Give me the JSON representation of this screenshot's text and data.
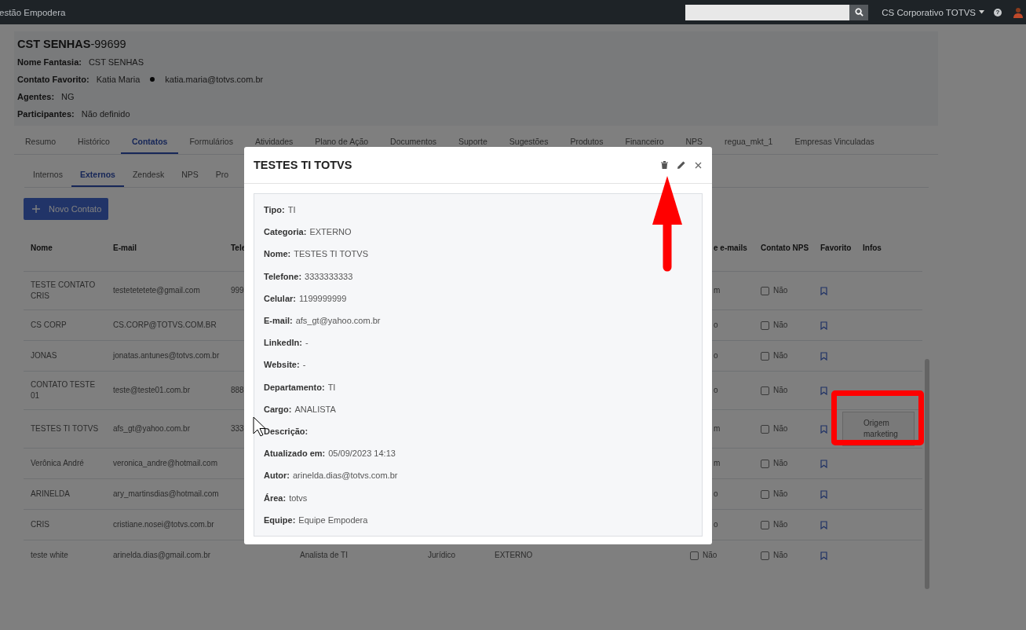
{
  "topbar": {
    "app_title": "estão Empodera",
    "account": "CS Corporativo TOTVS",
    "help": "?"
  },
  "company": {
    "title": "**CST SENHAS**-99699",
    "fields": [
      {
        "label": "Nome Fantasia:",
        "value": "CST SENHAS"
      },
      {
        "label": "Contato Favorito:",
        "value": "Katia Maria",
        "extra": "katia.maria@totvs.com.br"
      },
      {
        "label": "Agentes:",
        "value": "NG"
      },
      {
        "label": "Participantes:",
        "value": "Não definido"
      }
    ]
  },
  "tabs": [
    {
      "label": "Resumo",
      "selected": false
    },
    {
      "label": "Histórico",
      "selected": false
    },
    {
      "label": "Contatos",
      "selected": true
    },
    {
      "label": "Formulários",
      "selected": false
    },
    {
      "label": "Atividades",
      "selected": false
    },
    {
      "label": "Plano de Ação",
      "selected": false
    },
    {
      "label": "Documentos",
      "selected": false
    },
    {
      "label": "Suporte",
      "selected": false
    },
    {
      "label": "Sugestões",
      "selected": false
    },
    {
      "label": "Produtos",
      "selected": false
    },
    {
      "label": "Financeiro",
      "selected": false
    },
    {
      "label": "NPS",
      "selected": false
    },
    {
      "label": "regua_mkt_1",
      "selected": false
    },
    {
      "label": "Empresas Vinculadas",
      "selected": false
    }
  ],
  "subtabs": [
    {
      "label": "Internos",
      "selected": false
    },
    {
      "label": "Externos",
      "selected": true
    },
    {
      "label": "Zendesk",
      "selected": false
    },
    {
      "label": "NPS",
      "selected": false
    },
    {
      "label": "Pro",
      "selected": false
    }
  ],
  "new_button": "Novo Contato",
  "table": {
    "columns": [
      "Nome",
      "E-mail",
      "Tele",
      "",
      "",
      "",
      "e e-mails",
      "Contato NPS",
      "Favorito",
      "Infos"
    ],
    "rows": [
      {
        "name": "TESTE CONTATO CRIS",
        "email": "testetetetete@gmail.com",
        "phone": "999",
        "emails": {
          "kind": "fragment",
          "text": "m"
        },
        "nps": {
          "checked": false,
          "text": "Não"
        }
      },
      {
        "name": "CS CORP",
        "email": "CS.CORP@TOTVS.COM.BR",
        "emails": {
          "kind": "fragment",
          "text": "o"
        },
        "nps": {
          "checked": false,
          "text": "Não"
        }
      },
      {
        "name": "JONAS",
        "email": "jonatas.antunes@totvs.com.br",
        "emails": {
          "kind": "fragment",
          "text": "o"
        },
        "nps": {
          "checked": false,
          "text": "Não"
        }
      },
      {
        "name": "CONTATO TESTE 01",
        "email": "teste@teste01.com.br",
        "phone": "888",
        "emails": {
          "kind": "fragment",
          "text": "o"
        },
        "nps": {
          "checked": false,
          "text": "Não"
        }
      },
      {
        "name": "TESTES TI TOTVS",
        "email": "afs_gt@yahoo.com.br",
        "phone": "333",
        "emails": {
          "kind": "fragment",
          "text": "m"
        },
        "nps": {
          "checked": false,
          "text": "Não"
        },
        "infos": "Origem marketing"
      },
      {
        "name": "Verônica André",
        "email": "veronica_andre@hotmail.com",
        "emails": {
          "kind": "fragment",
          "text": "m"
        },
        "nps": {
          "checked": false,
          "text": "Não"
        }
      },
      {
        "name": "ARINELDA",
        "email": "ary_martinsdias@hotmail.com",
        "emails": {
          "kind": "fragment",
          "text": "o"
        },
        "nps": {
          "checked": false,
          "text": "Não"
        }
      },
      {
        "name": "CRIS",
        "email": "cristiane.nosei@totvs.com.br",
        "emails": {
          "kind": "fragment",
          "text": "o"
        },
        "nps": {
          "checked": false,
          "text": "Não"
        }
      },
      {
        "name": "teste white",
        "email": "arinelda.dias@gmail.com.br",
        "cargo": "Analista de TI",
        "department": "Jurídico",
        "category": "EXTERNO",
        "emails": {
          "kind": "checkbox",
          "checked": false,
          "text": "Não"
        },
        "nps": {
          "checked": false,
          "text": "Não"
        }
      }
    ]
  },
  "modal": {
    "title": "TESTES TI TOTVS",
    "details": [
      {
        "label": "Tipo:",
        "value": "TI"
      },
      {
        "label": "Categoria:",
        "value": "EXTERNO"
      },
      {
        "label": "Nome:",
        "value": "TESTES TI TOTVS"
      },
      {
        "label": "Telefone:",
        "value": "3333333333"
      },
      {
        "label": "Celular:",
        "value": "1199999999"
      },
      {
        "label": "E-mail:",
        "value": "afs_gt@yahoo.com.br"
      },
      {
        "label": "LinkedIn:",
        "value": "-"
      },
      {
        "label": "Website:",
        "value": "-"
      },
      {
        "label": "Departamento:",
        "value": "TI"
      },
      {
        "label": "Cargo:",
        "value": "ANALISTA"
      },
      {
        "label": "Descrição:"
      },
      {
        "label": "Atualizado em:",
        "value": "05/09/2023 14:13"
      },
      {
        "label": "Autor:",
        "value": "arinelda.dias@totvs.com.br"
      },
      {
        "label": "Área:",
        "value": "totvs"
      },
      {
        "label": "Equipe:",
        "value": "Equipe Empodera"
      }
    ]
  }
}
